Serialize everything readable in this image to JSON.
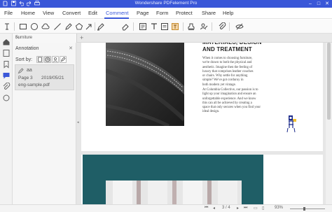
{
  "window": {
    "title": "Wondershare PDFelement Pro",
    "controls": {
      "minimize": "–",
      "maximize": "□",
      "close": "✕"
    }
  },
  "quick_access": [
    "save-icon",
    "undo-icon",
    "redo-icon",
    "print-icon"
  ],
  "menu": {
    "items": [
      "File",
      "Home",
      "View",
      "Convert",
      "Edit",
      "Comment",
      "Page",
      "Form",
      "Protect",
      "Share",
      "Help"
    ],
    "active": "Comment"
  },
  "toolbar": {
    "tools": [
      "text-cursor-icon",
      "rectangle-icon",
      "circle-icon",
      "cloud-icon",
      "line-icon",
      "pencil-icon",
      "polygon-icon",
      "arrow-icon",
      "eraser-icon",
      "textbox-icon",
      "typewriter-icon",
      "note-icon",
      "text-callout-icon",
      "stamp-icon",
      "signature-icon",
      "attachment-icon",
      "hide-annotations-icon"
    ]
  },
  "tabs": [
    {
      "label": "Furniture",
      "close": "✕"
    }
  ],
  "tab_add": "+",
  "annotation_panel": {
    "title": "Annotation",
    "close": "✕",
    "sort_label": "Sort by:",
    "items": [
      {
        "text": "aa",
        "page": "Page 3",
        "date": "2019/05/21",
        "file": "eng-sample.pdf"
      }
    ]
  },
  "document": {
    "heading_line1": "MATERIALS, DESIGN",
    "heading_line2": "AND TREATMENT",
    "para1": [
      "When it comes to choosing furniture,",
      "we're drawn to both the physical and",
      "aesthetic. Imagine then the feeling of",
      "luxury that comprises leather couches",
      "or chairs. Why settle for anything",
      "simple? We've got corduroy in",
      "both modern yet vintage."
    ],
    "para2": [
      "At Columbia Collective, our passion is to",
      "light up your imagination and ensure an",
      "unforgettable experience. And we know",
      "this can all be achieved by creating a",
      "space that only secures when you find your",
      "ideal design."
    ],
    "collapse_arrow": "◂"
  },
  "status": {
    "page_nav": "3 / 4",
    "zoom": "93%"
  }
}
